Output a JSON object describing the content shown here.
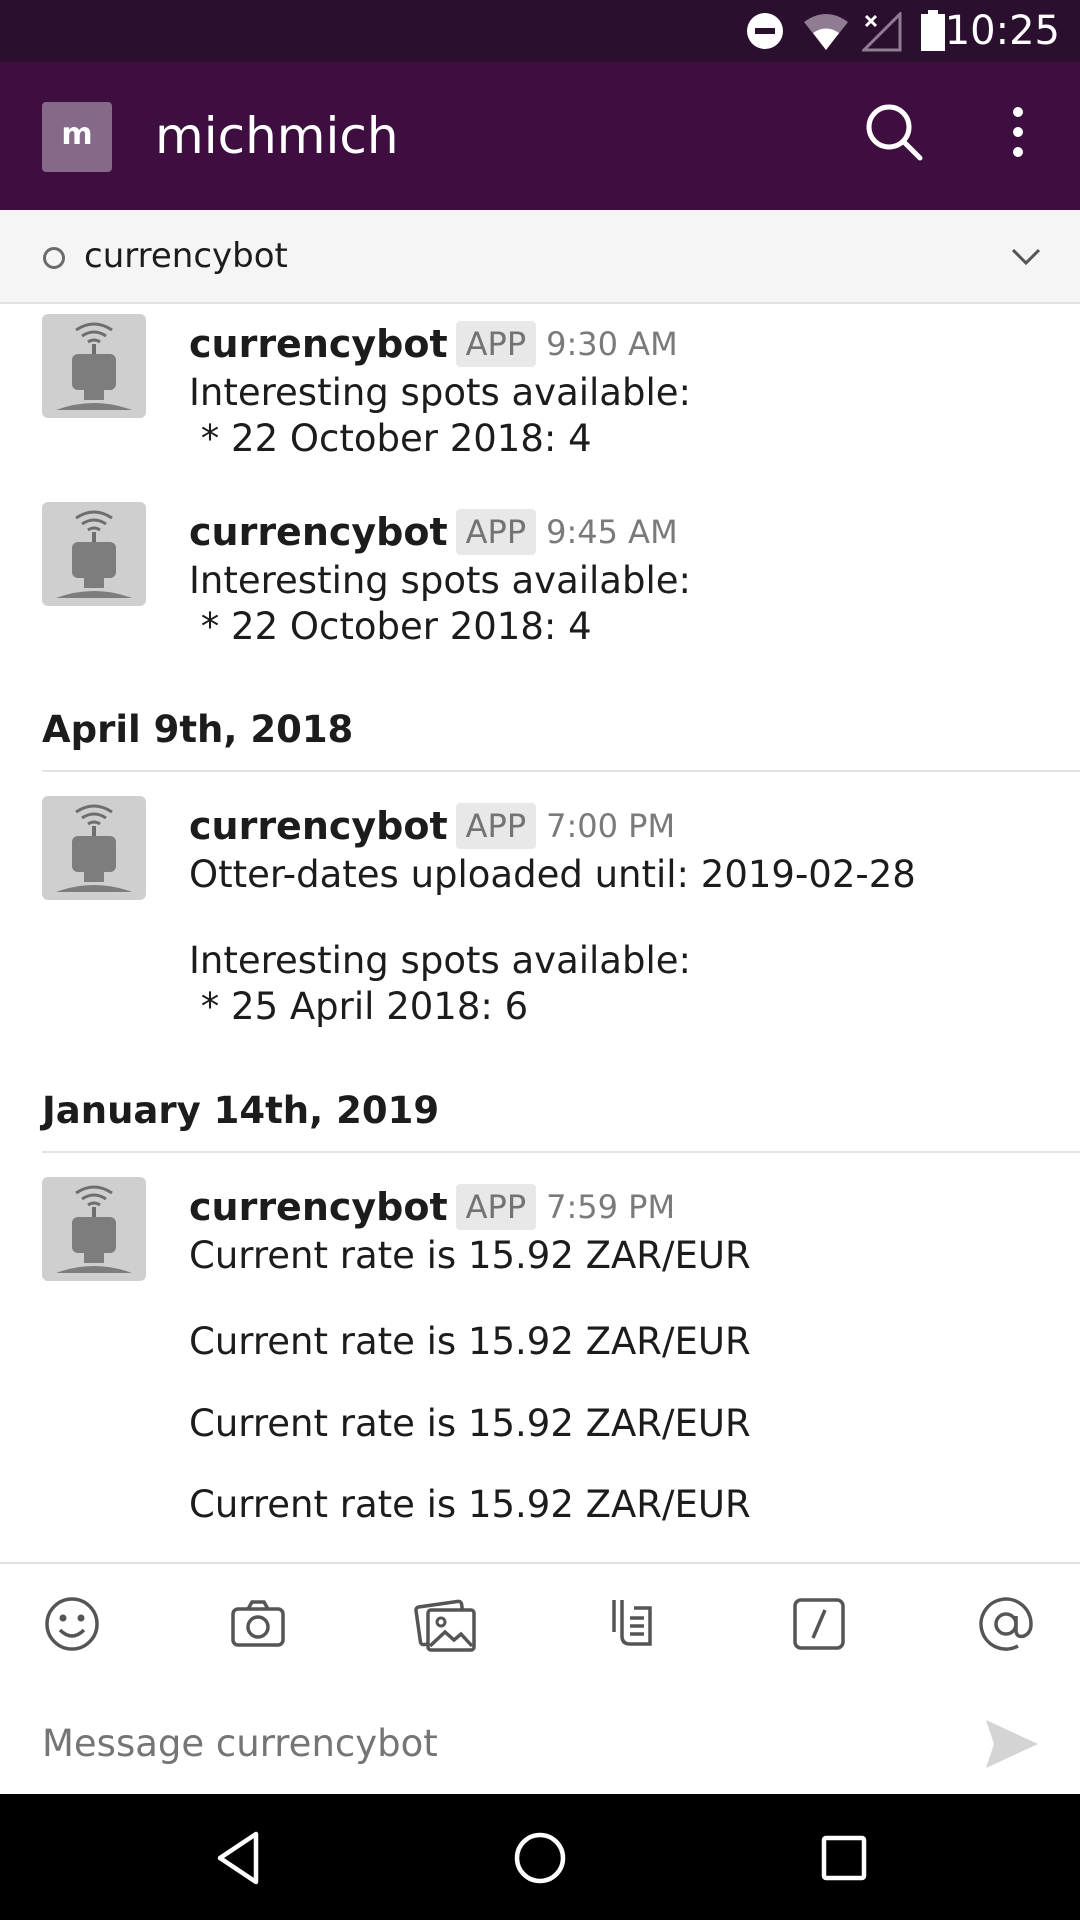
{
  "status_bar": {
    "time": "10:25"
  },
  "header": {
    "avatar_initial": "m",
    "workspace": "michmich"
  },
  "channel": {
    "name": "currencybot"
  },
  "messages": [
    {
      "sender": "currencybot",
      "badge": "APP",
      "time": "9:30 AM",
      "lines": [
        "Interesting spots available:",
        " * 22 October 2018: 4"
      ]
    },
    {
      "sender": "currencybot",
      "badge": "APP",
      "time": "9:45 AM",
      "lines": [
        "Interesting spots available:",
        " * 22 October 2018: 4"
      ]
    },
    {
      "sender": "currencybot",
      "badge": "APP",
      "time": "7:00 PM",
      "lines": [
        "Otter-dates uploaded until: 2019-02-28",
        "Interesting spots available:",
        " * 25 April 2018: 6"
      ]
    },
    {
      "sender": "currencybot",
      "badge": "APP",
      "time": "7:59 PM",
      "lines": [
        "Current rate is 15.92 ZAR/EUR",
        "Current rate is 15.92 ZAR/EUR",
        "Current rate is 15.92 ZAR/EUR",
        "Current rate is 15.92 ZAR/EUR"
      ]
    }
  ],
  "day_dividers": [
    "April 9th, 2018",
    "January 14th, 2019"
  ],
  "composer": {
    "placeholder": "Message currencybot"
  }
}
